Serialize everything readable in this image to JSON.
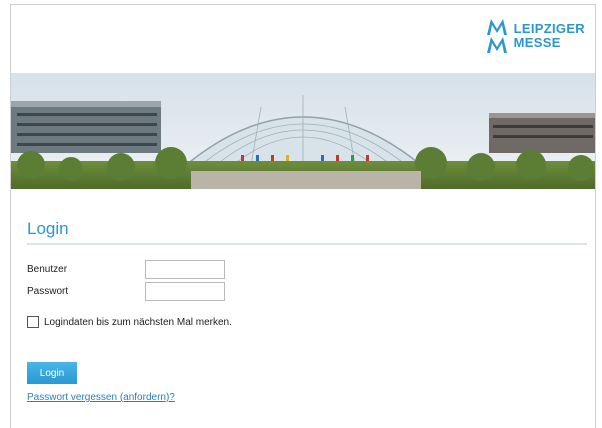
{
  "brand": {
    "line1": "LEIPZIGER",
    "line2": "MESSE",
    "color": "#2b97cf",
    "icon": "leipziger-messe-logo-icon"
  },
  "banner": {
    "description_icon": "fair-glass-hall-photo"
  },
  "login": {
    "title": "Login",
    "username_label": "Benutzer",
    "username_value": "",
    "password_label": "Passwort",
    "password_value": "",
    "remember_label": "Logindaten bis zum nächsten Mal merken.",
    "remember_checked": false,
    "submit_label": "Login",
    "forgot_link": "Passwort vergessen (anfordern)?"
  },
  "colors": {
    "accent": "#2b97cf",
    "button": "#3aa8de",
    "link": "#2b7fc1",
    "divider": "#d9e6ee"
  }
}
